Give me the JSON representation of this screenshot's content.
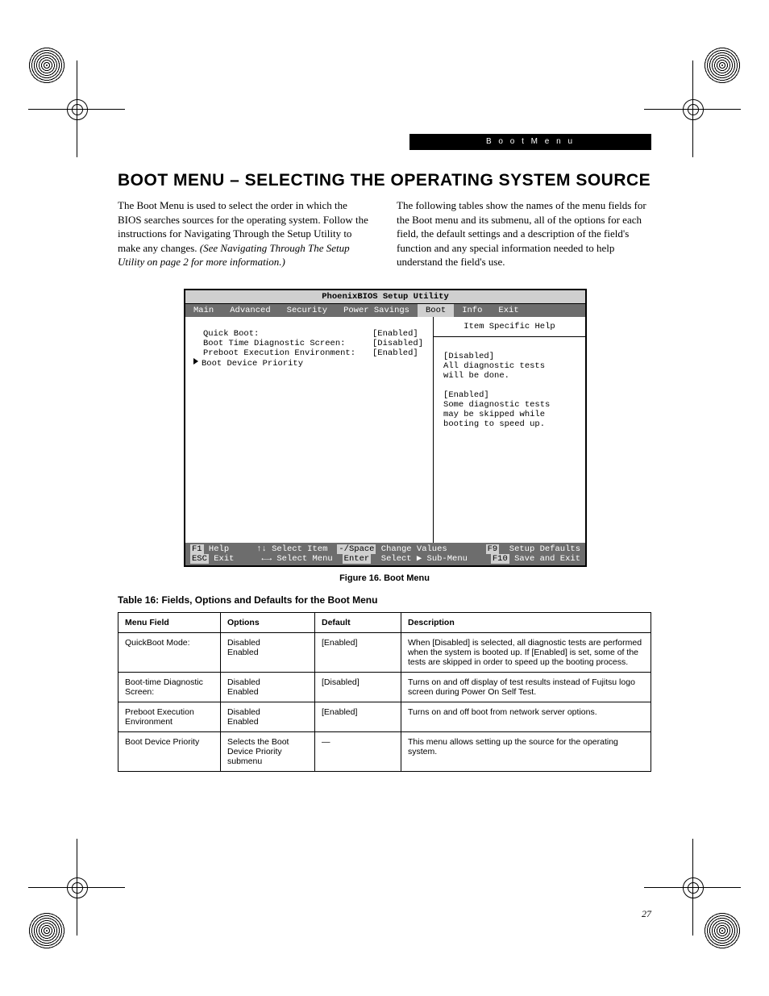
{
  "header_bar": "B o o t   M e n u",
  "title": "BOOT MENU – SELECTING THE OPERATING SYSTEM SOURCE",
  "para_left_a": "The Boot Menu is used to select the order in which the BIOS searches sources for the operating system. Follow the instructions for Navigating Through the Setup Utility to make any changes. ",
  "para_left_b": "(See Navigating Through The Setup Utility on page 2 for more information.)",
  "para_right": "The following tables show the names of the menu fields for the Boot menu and its submenu, all of the options for each field, the default settings and a description of the field's function and any special information needed to help understand the field's use.",
  "bios": {
    "title": "PhoenixBIOS Setup Utility",
    "menu": [
      "Main",
      "Advanced",
      "Security",
      "Power Savings",
      "Boot",
      "Info",
      "Exit"
    ],
    "selected_menu": "Boot",
    "rows": [
      {
        "label": "Quick Boot:",
        "value": "[Enabled]"
      },
      {
        "label": "Boot Time Diagnostic Screen:",
        "value": "[Disabled]"
      },
      {
        "label": "",
        "value": ""
      },
      {
        "label": "Preboot Execution Environment:",
        "value": "[Enabled]"
      }
    ],
    "submenu_row": "Boot Device Priority",
    "help_title": "Item Specific Help",
    "help_lines": [
      "[Disabled]",
      "All diagnostic tests",
      "will be done.",
      "",
      "[Enabled]",
      "Some diagnostic tests",
      "may be skipped while",
      "booting to speed up."
    ],
    "foot1": {
      "k1": "F1",
      "t1": "Help",
      "arr1": "↑↓",
      "t2": "Select Item",
      "k2": "-/Space",
      "t3": "Change Values",
      "k3": "F9",
      "t4": "Setup Defaults"
    },
    "foot2": {
      "k1": "ESC",
      "t1": "Exit",
      "arr1": "←→",
      "t2": "Select Menu",
      "k2": "Enter",
      "t3": "Select ▶ Sub-Menu",
      "k3": "F10",
      "t4": "Save and Exit"
    }
  },
  "figure_caption": "Figure 16.  Boot Menu",
  "table_caption": "Table 16: Fields, Options and Defaults for the Boot Menu",
  "table_head": [
    "Menu Field",
    "Options",
    "Default",
    "Description"
  ],
  "table_rows": [
    {
      "f": "QuickBoot Mode:",
      "o": "Disabled\nEnabled",
      "d": "[Enabled]",
      "desc": "When [Disabled] is selected, all diagnostic tests are performed when the system is booted up. If [Enabled] is set, some of the tests are skipped in order to speed up the booting process."
    },
    {
      "f": "Boot-time Diagnostic Screen:",
      "o": "Disabled\nEnabled",
      "d": "[Disabled]",
      "desc": "Turns on and off display of test results instead of Fujitsu logo screen during Power On Self Test."
    },
    {
      "f": "Preboot Execution Environment",
      "o": "Disabled\nEnabled",
      "d": "[Enabled]",
      "desc": "Turns on and off boot from network server options."
    },
    {
      "f": "Boot Device Priority",
      "o": "Selects the Boot Device Priority submenu",
      "d": "—",
      "desc": "This menu allows setting up the source for the operating system."
    }
  ],
  "page_number": "27"
}
